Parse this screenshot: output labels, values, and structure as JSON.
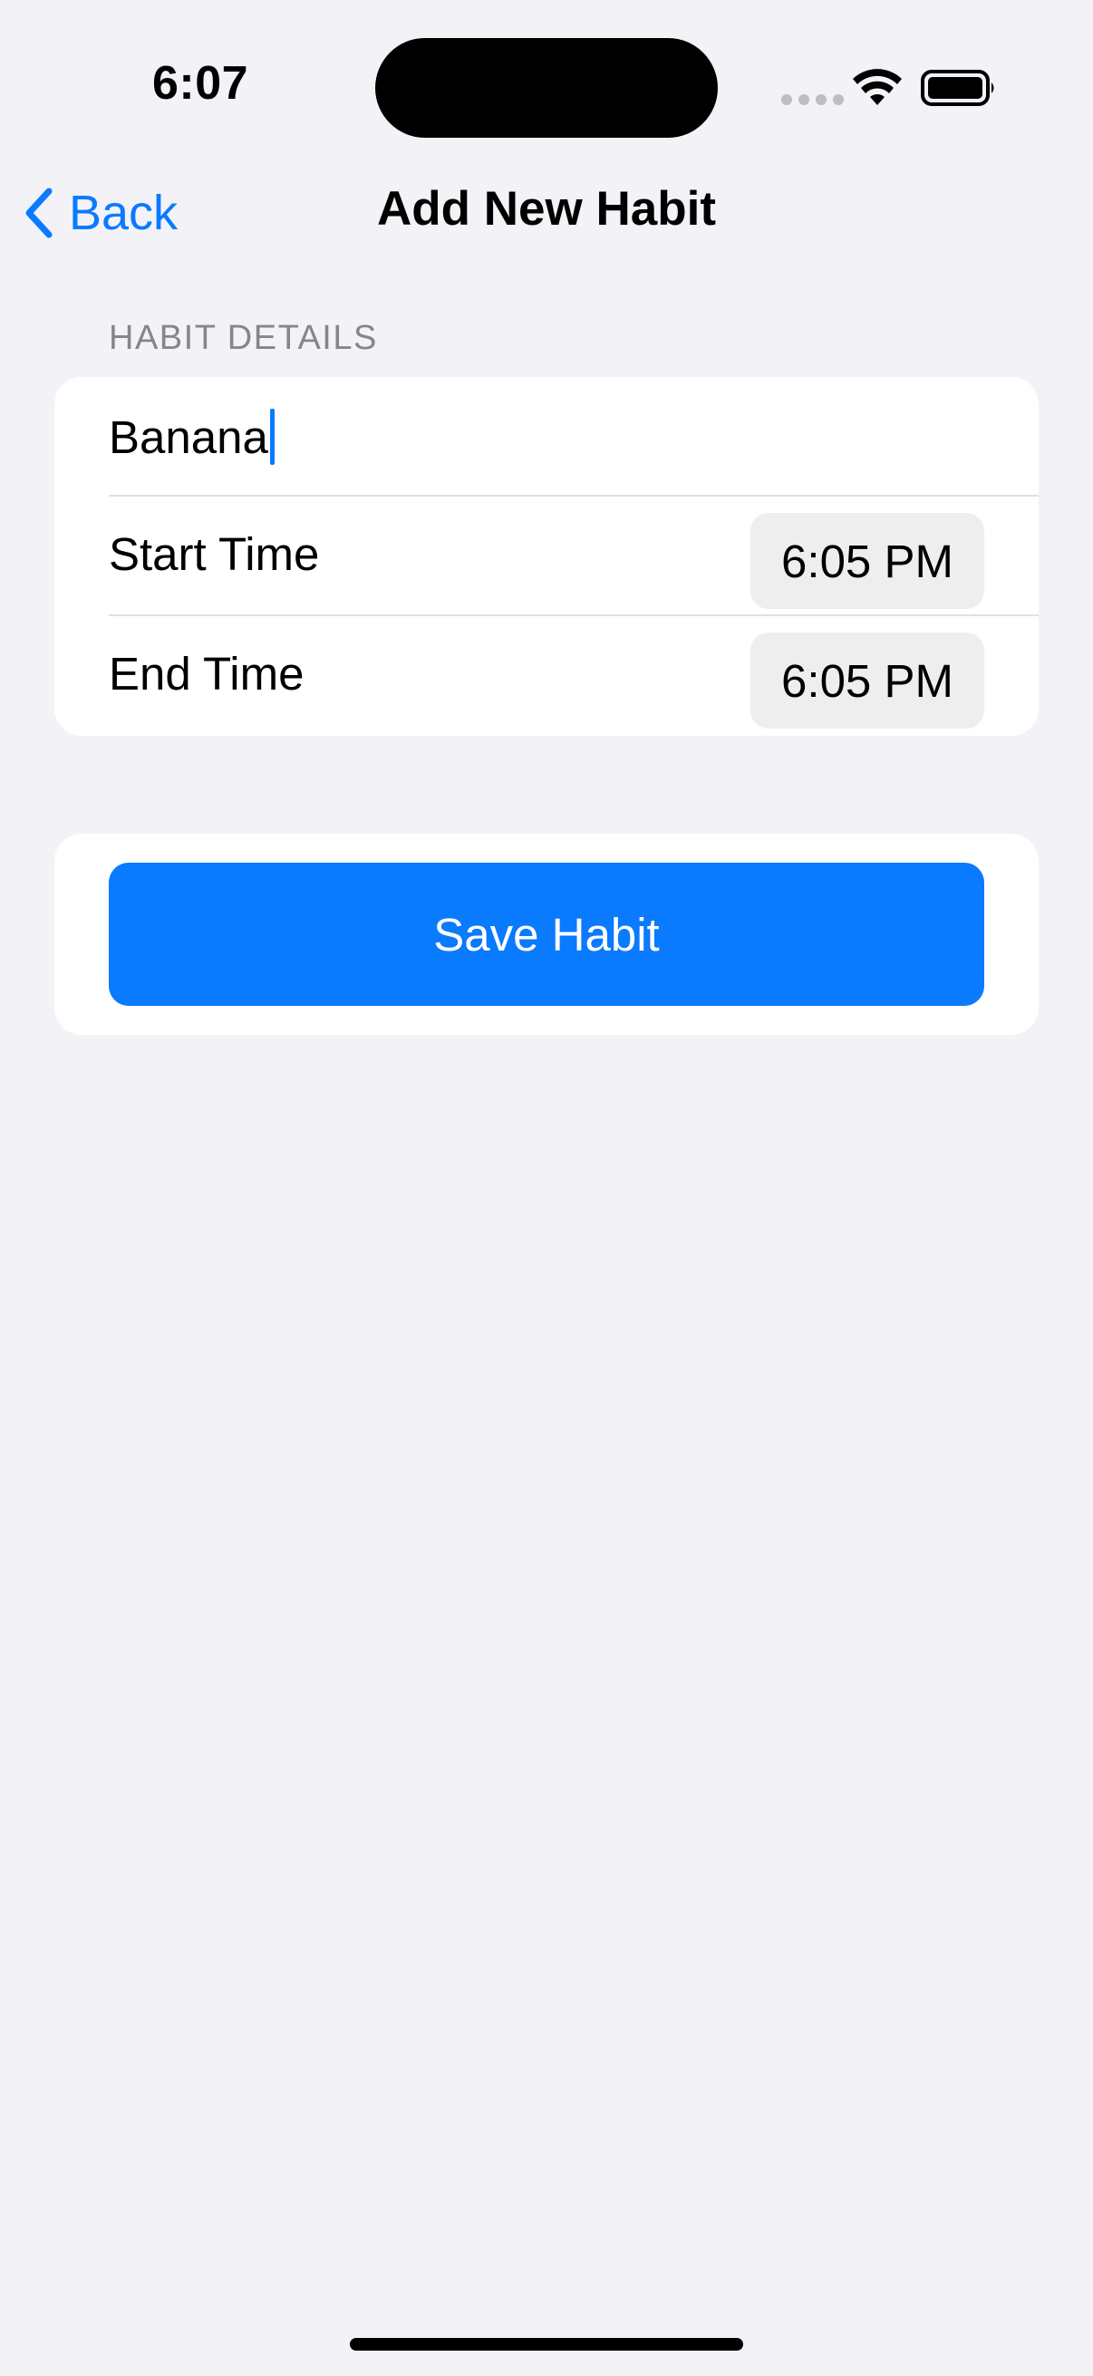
{
  "status_bar": {
    "time": "6:07"
  },
  "nav": {
    "back_label": "Back",
    "title": "Add New Habit"
  },
  "section": {
    "header": "HABIT DETAILS"
  },
  "form": {
    "name_value": "Banana",
    "start_time_label": "Start Time",
    "start_time_value": "6:05 PM",
    "end_time_label": "End Time",
    "end_time_value": "6:05 PM"
  },
  "actions": {
    "save_label": "Save Habit"
  },
  "colors": {
    "accent": "#0A7AFF",
    "background": "#F2F2F7",
    "card": "#FFFFFF",
    "secondary_text": "#85858B"
  }
}
